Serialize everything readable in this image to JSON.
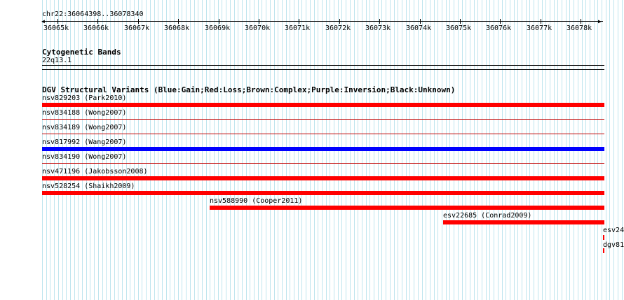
{
  "ruler": {
    "location": "chr22:36064398..36078340",
    "ticks": [
      "36065k",
      "36066k",
      "36067k",
      "36068k",
      "36069k",
      "36070k",
      "36071k",
      "36072k",
      "36073k",
      "36074k",
      "36075k",
      "36076k",
      "36077k",
      "36078k"
    ]
  },
  "cytogenetic": {
    "title": "Cytogenetic Bands",
    "band": "22q13.1"
  },
  "dgv": {
    "title": "DGV Structural Variants (Blue:Gain;Red:Loss;Brown:Complex;Purple:Inversion;Black:Unknown)",
    "colors": {
      "loss": "#ff0000",
      "gain": "#0000ff",
      "thin": "#c00000"
    },
    "variants": [
      {
        "label": "nsv829203 (Park2010)",
        "type": "loss",
        "thick": true
      },
      {
        "label": "nsv834188 (Wong2007)",
        "type": "loss",
        "thick": false
      },
      {
        "label": "nsv834189 (Wong2007)",
        "type": "loss",
        "thick": false
      },
      {
        "label": "nsv817992 (Wang2007)",
        "type": "gain",
        "thick": true
      },
      {
        "label": "nsv834190 (Wong2007)",
        "type": "loss",
        "thick": false
      },
      {
        "label": "nsv471196 (Jakobsson2008)",
        "type": "loss",
        "thick": true
      },
      {
        "label": "nsv528254 (Shaikh2009)",
        "type": "loss",
        "thick": true
      },
      {
        "label": "nsv588990 (Cooper2011)",
        "type": "loss",
        "thick": true
      },
      {
        "label": "esv22685 (Conrad2009)",
        "type": "loss",
        "thick": true
      },
      {
        "label": "esv24",
        "type": "loss",
        "thick": false
      },
      {
        "label": "dgv81",
        "type": "loss",
        "thick": false
      }
    ]
  }
}
